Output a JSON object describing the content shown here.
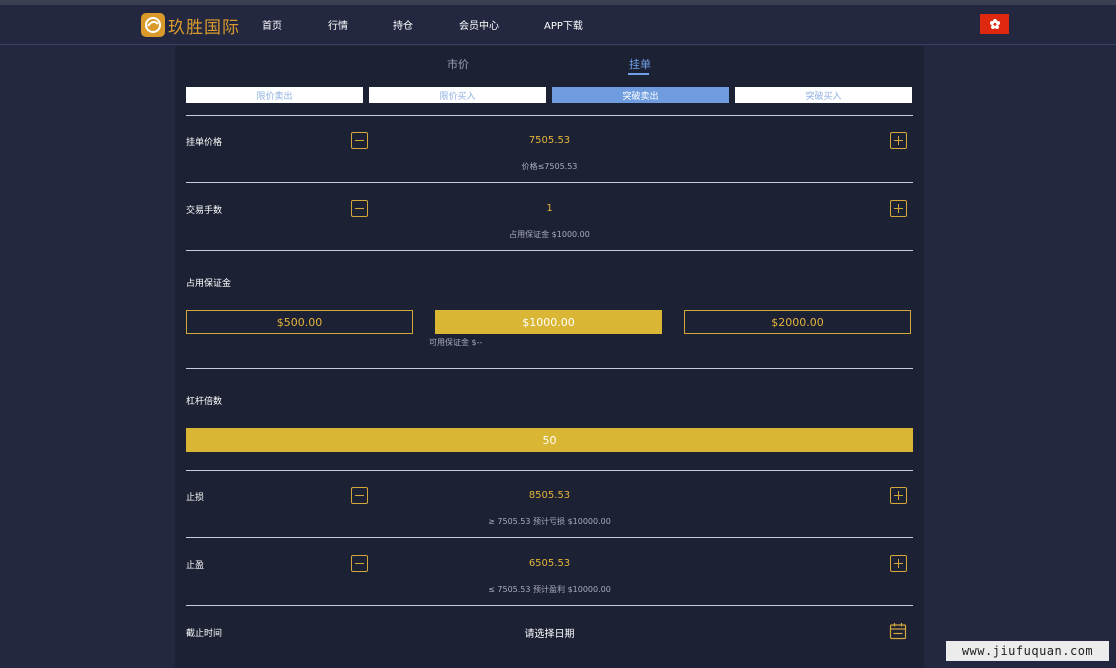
{
  "header": {
    "brand": "玖胜国际",
    "nav": [
      "首页",
      "行情",
      "持仓",
      "会员中心",
      "APP下载"
    ]
  },
  "tabs": [
    {
      "label": "市价",
      "active": false
    },
    {
      "label": "挂单",
      "active": true
    }
  ],
  "order_types": [
    {
      "label": "限价卖出",
      "active": false
    },
    {
      "label": "限价买入",
      "active": false
    },
    {
      "label": "突破卖出",
      "active": true
    },
    {
      "label": "突破买入",
      "active": false
    }
  ],
  "pending_price": {
    "label": "挂单价格",
    "value": "7505.53",
    "hint": "价格≤7505.53"
  },
  "lots": {
    "label": "交易手数",
    "value": "1",
    "hint": "占用保证金 $1000.00"
  },
  "margin": {
    "label": "占用保证金",
    "options": [
      {
        "label": "$500.00",
        "active": false
      },
      {
        "label": "$1000.00",
        "active": true
      },
      {
        "label": "$2000.00",
        "active": false
      }
    ],
    "available": "可用保证金 $--"
  },
  "leverage": {
    "label": "杠杆倍数",
    "value": "50"
  },
  "stop_loss": {
    "label": "止损",
    "value": "8505.53",
    "hint": "≥ 7505.53 预计亏损 $10000.00"
  },
  "take_profit": {
    "label": "止盈",
    "value": "6505.53",
    "hint": "≤ 7505.53 预计盈利 $10000.00"
  },
  "expiry": {
    "label": "截止时间",
    "placeholder": "请选择日期"
  },
  "watermark": "www.jiufuquan.com",
  "colors": {
    "accent_gold": "#d9b633",
    "accent_blue": "#6e9cde",
    "background": "#232840",
    "panel": "#1d2134"
  }
}
